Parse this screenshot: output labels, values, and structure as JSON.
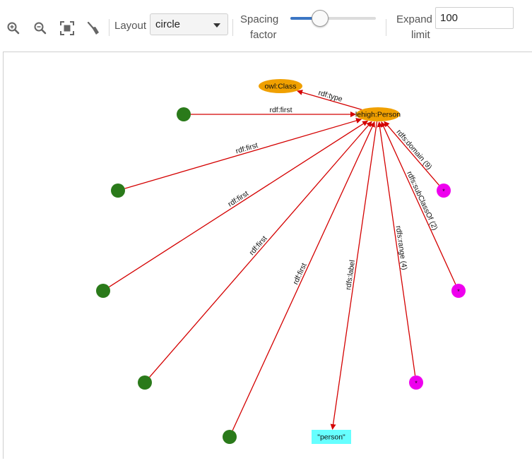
{
  "toolbar": {
    "zoom_in_icon": "zoom-in-icon",
    "zoom_out_icon": "zoom-out-icon",
    "fit_icon": "fit-to-screen-icon",
    "clear_icon": "broom-icon",
    "layout_label": "Layout",
    "layout_value": "circle",
    "spacing_label_1": "Spacing",
    "spacing_label_2": "factor",
    "spacing_value": 0.3,
    "expand_label_1": "Expand",
    "expand_label_2": "limit",
    "expand_value": "100"
  },
  "graph": {
    "colors": {
      "edge": "#d40000",
      "class_node": "#f0a000",
      "blank_node": "#2a7a1a",
      "list_node": "#ee00ee",
      "literal_node": "#66ffff"
    },
    "nodes": [
      {
        "id": "owl",
        "label": "owl:Class",
        "kind": "class"
      },
      {
        "id": "person",
        "label": "lehigh:Person",
        "kind": "class"
      },
      {
        "id": "g1",
        "label": "",
        "kind": "blank"
      },
      {
        "id": "g2",
        "label": "",
        "kind": "blank"
      },
      {
        "id": "g3",
        "label": "",
        "kind": "blank"
      },
      {
        "id": "g4",
        "label": "",
        "kind": "blank"
      },
      {
        "id": "g5",
        "label": "",
        "kind": "blank"
      },
      {
        "id": "m1",
        "label": "*",
        "kind": "list"
      },
      {
        "id": "m2",
        "label": "*",
        "kind": "list"
      },
      {
        "id": "m3",
        "label": "*",
        "kind": "list"
      },
      {
        "id": "lit",
        "label": "\"person\"",
        "kind": "literal"
      }
    ],
    "edges": [
      {
        "source": "person",
        "target": "owl",
        "label": "rdf:type"
      },
      {
        "source": "g1",
        "target": "person",
        "label": "rdf:first"
      },
      {
        "source": "g2",
        "target": "person",
        "label": "rdf:first"
      },
      {
        "source": "g3",
        "target": "person",
        "label": "rdf:first"
      },
      {
        "source": "g4",
        "target": "person",
        "label": "rdf:first"
      },
      {
        "source": "g5",
        "target": "person",
        "label": "rdf:first"
      },
      {
        "source": "person",
        "target": "lit",
        "label": "rdfs:label"
      },
      {
        "source": "m1",
        "target": "person",
        "label": "rdfs:domain (9)"
      },
      {
        "source": "m2",
        "target": "person",
        "label": "rdfs:subClassOf (2)"
      },
      {
        "source": "m3",
        "target": "person",
        "label": "rdfs:range (4)"
      }
    ]
  }
}
